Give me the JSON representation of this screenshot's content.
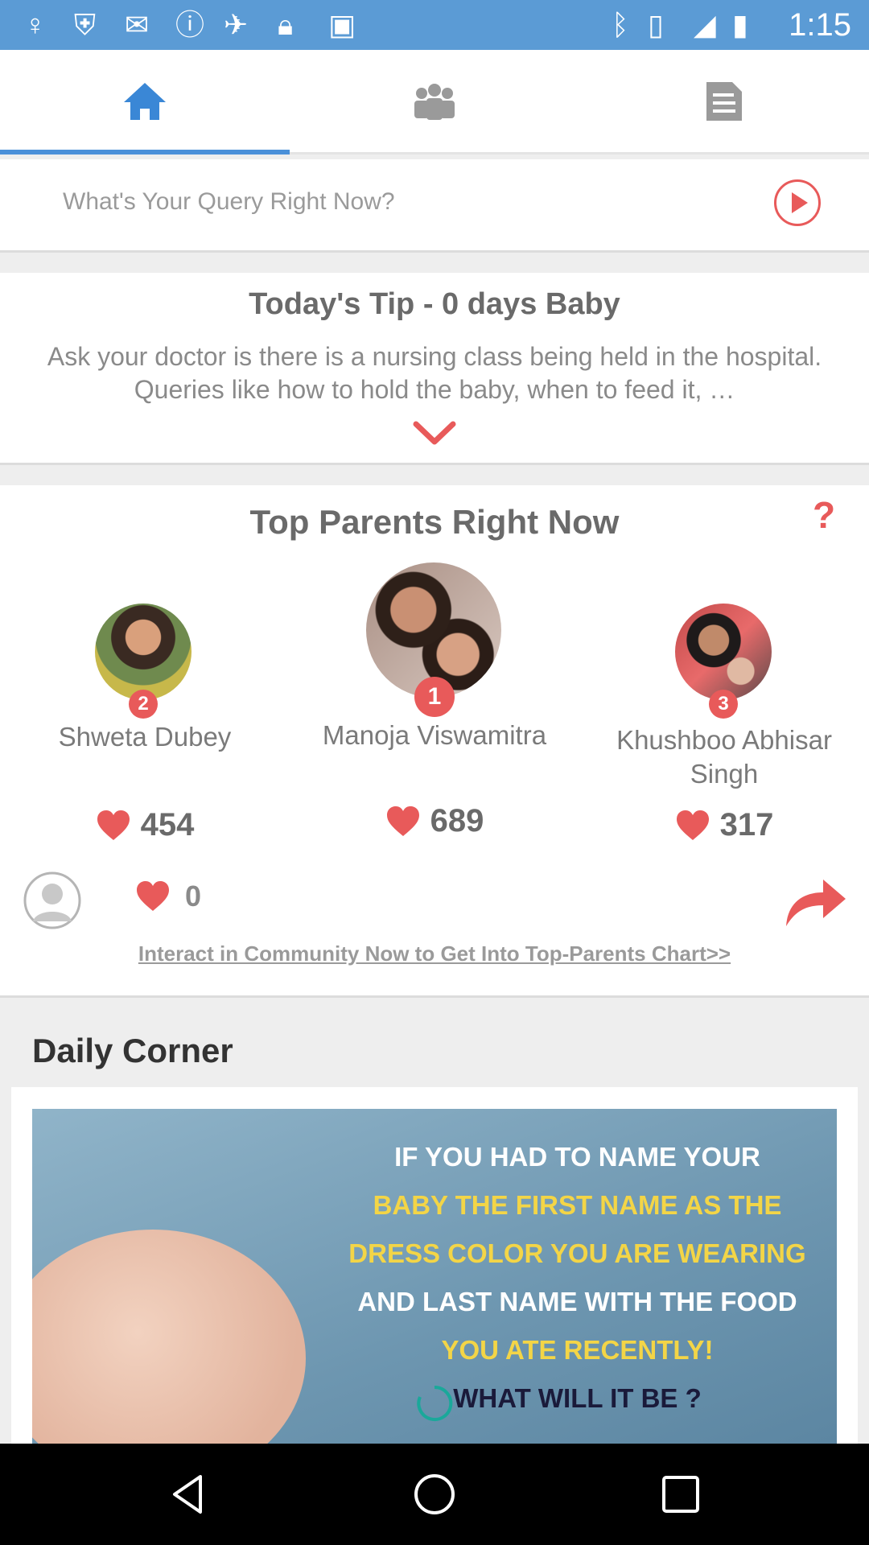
{
  "status_bar": {
    "time": "1:15"
  },
  "tabs": [
    {
      "name": "home",
      "icon": "home-icon",
      "active": true
    },
    {
      "name": "community",
      "icon": "people-icon",
      "active": false
    },
    {
      "name": "articles",
      "icon": "article-icon",
      "active": false
    }
  ],
  "query": {
    "placeholder": "What's Your Query Right Now?"
  },
  "tip": {
    "title": "Today's Tip - 0 days Baby",
    "body": "Ask your doctor is there is a nursing class being held in the hospital. Queries like how to hold the baby, when to feed it, …"
  },
  "top_parents": {
    "title": "Top Parents Right Now",
    "help_mark": "?",
    "parents": [
      {
        "rank": "2",
        "name": "Shweta Dubey",
        "likes": "454"
      },
      {
        "rank": "1",
        "name": "Manoja Viswamitra",
        "likes": "689"
      },
      {
        "rank": "3",
        "name": "Khushboo Abhisar Singh",
        "likes": "317"
      }
    ],
    "my_likes": "0",
    "interact_text": "Interact in Community Now to Get Into Top-Parents Chart>>"
  },
  "daily_corner": {
    "title": "Daily Corner",
    "image_text": [
      "IF YOU HAD TO NAME YOUR",
      "BABY THE FIRST NAME AS THE",
      "DRESS COLOR YOU ARE WEARING",
      "AND LAST NAME WITH THE FOOD",
      "YOU ATE RECENTLY!",
      "WHAT WILL IT BE ?"
    ]
  },
  "colors": {
    "accent": "#e85a5a",
    "primary": "#4a90d9",
    "status_bar": "#5b9bd5"
  }
}
